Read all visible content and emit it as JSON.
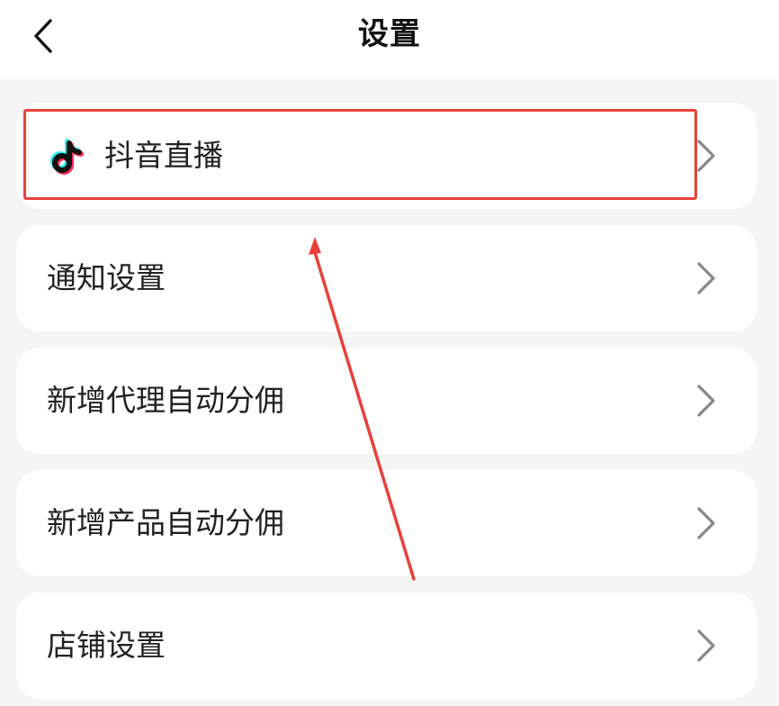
{
  "header": {
    "title": "设置",
    "back_icon": "chevron-left-icon"
  },
  "settings_items": [
    {
      "label": "抖音直播",
      "icon": "douyin-logo-icon",
      "highlighted": true
    },
    {
      "label": "通知设置"
    },
    {
      "label": "新增代理自动分佣"
    },
    {
      "label": "新增产品自动分佣"
    },
    {
      "label": "店铺设置"
    }
  ],
  "chevron_icon": "chevron-right-icon",
  "colors": {
    "background": "#f5f5f5",
    "card": "#ffffff",
    "text": "#222222",
    "chevron": "#888888",
    "annotation": "#e8413a",
    "douyin_cyan": "#25f4ee",
    "douyin_pink": "#fe2c55"
  }
}
